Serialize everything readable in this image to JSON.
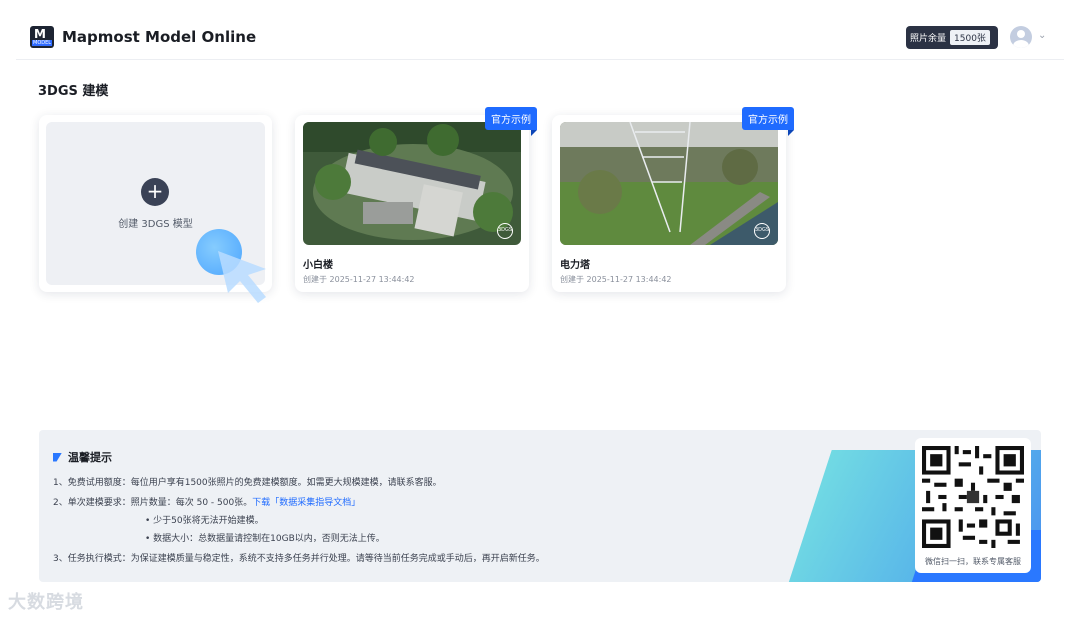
{
  "header": {
    "logo_text": "M",
    "logo_subtext": "MODEL",
    "app_title": "Mapmost Model Online",
    "quota_label": "照片余量",
    "quota_value": "1500张",
    "avatar_icon": "user-avatar-icon",
    "menu_icon": "chevron-down-icon"
  },
  "section": {
    "title": "3DGS 建模"
  },
  "create_card": {
    "label": "创建 3DGS 模型"
  },
  "models": [
    {
      "badge": "官方示例",
      "name": "小白楼",
      "created": "创建于 2025-11-27 13:44:42",
      "badge_3d": "3DGS"
    },
    {
      "badge": "官方示例",
      "name": "电力塔",
      "created": "创建于 2025-11-27 13:44:42",
      "badge_3d": "3DGS"
    }
  ],
  "tips": {
    "title": "温馨提示",
    "line1": "1、免费试用额度：每位用户享有1500张照片的免费建模额度。如需更大规模建模，请联系客服。",
    "line2_prefix": "2、单次建模要求：照片数量：每次 50 - 500张。",
    "line2_link": "下载「数据采集指导文档」",
    "line2_sub1": "• 少于50张将无法开始建模。",
    "line2_sub2": "• 数据大小：总数据量请控制在10GB以内，否则无法上传。",
    "line3": "3、任务执行模式：为保证建模质量与稳定性，系统不支持多任务并行处理。请等待当前任务完成或手动后，再开启新任务。",
    "qr_caption": "微信扫一扫，联系专属客服"
  },
  "watermark": "大数跨境",
  "colors": {
    "accent": "#1f6bff",
    "dark": "#2b3244",
    "panel": "#eef1f5"
  }
}
